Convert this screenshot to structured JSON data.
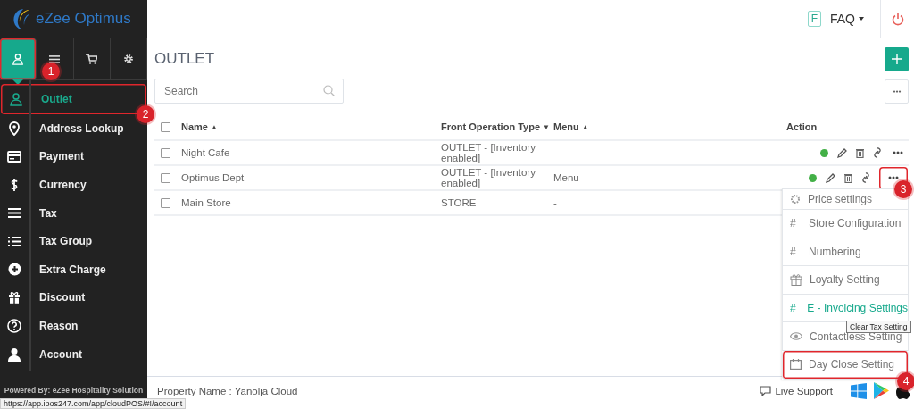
{
  "brand": {
    "name": "eZee Optimus"
  },
  "sidebar": {
    "tabs": [
      {
        "selected": true,
        "highlighted": true
      },
      {
        "selected": false,
        "highlighted": false
      },
      {
        "selected": false,
        "highlighted": false
      },
      {
        "selected": false,
        "highlighted": false
      }
    ],
    "items": [
      {
        "label": "Outlet",
        "selected": true,
        "highlighted": true
      },
      {
        "label": "Address Lookup",
        "selected": false,
        "highlighted": false
      },
      {
        "label": "Payment",
        "selected": false,
        "highlighted": false
      },
      {
        "label": "Currency",
        "selected": false,
        "highlighted": false
      },
      {
        "label": "Tax",
        "selected": false,
        "highlighted": false
      },
      {
        "label": "Tax Group",
        "selected": false,
        "highlighted": false
      },
      {
        "label": "Extra Charge",
        "selected": false,
        "highlighted": false
      },
      {
        "label": "Discount",
        "selected": false,
        "highlighted": false
      },
      {
        "label": "Reason",
        "selected": false,
        "highlighted": false
      },
      {
        "label": "Account",
        "selected": false,
        "highlighted": false
      }
    ],
    "footer": "Powered By: eZee Hospitality Solution"
  },
  "topbar": {
    "faq_badge": "F",
    "faq": "FAQ"
  },
  "page": {
    "title": "OUTLET",
    "search": {
      "placeholder": "Search"
    }
  },
  "table": {
    "header_checked": false,
    "columns": [
      {
        "label": "Name",
        "sort": "▲"
      },
      {
        "label": "Front Operation Type",
        "sort": "▼"
      },
      {
        "label": "Menu",
        "sort": "▲"
      },
      {
        "label": "Action"
      }
    ],
    "rows": [
      {
        "checked": false,
        "name": "Night Cafe",
        "type": "OUTLET - [Inventory enabled]",
        "active": true,
        "more_highlighted": false
      },
      {
        "checked": false,
        "name": "Optimus Dept",
        "type": "OUTLET - [Inventory enabled]",
        "menu": "Menu",
        "active": true,
        "more_highlighted": true
      },
      {
        "checked": false,
        "name": "Main Store",
        "type": "STORE",
        "menu": "-"
      }
    ]
  },
  "action_menu": {
    "items": [
      {
        "label": "Price settings",
        "selected": false,
        "highlighted": false
      },
      {
        "label": "Store Configuration",
        "marker": "#",
        "selected": false,
        "highlighted": false
      },
      {
        "label": "Numbering",
        "marker": "#",
        "selected": false,
        "highlighted": false
      },
      {
        "label": "Loyalty Setting",
        "selected": false,
        "highlighted": false
      },
      {
        "label": "E - Invoicing Settings",
        "marker": "#",
        "selected": true,
        "highlighted": false
      },
      {
        "label": "Contactless Setting",
        "selected": false,
        "highlighted": false
      },
      {
        "label": "Day Close Setting",
        "selected": false,
        "highlighted": true
      }
    ]
  },
  "tooltip": "Clear Tax Setting",
  "footer": {
    "property": "Property Name : Yanolja Cloud",
    "support": "Live Support"
  },
  "status_url": "https://app.ipos247.com/app/cloudPOS/#!/account",
  "annotations": [
    {
      "label": "1"
    },
    {
      "label": "2"
    },
    {
      "label": "3"
    },
    {
      "label": "4"
    }
  ]
}
